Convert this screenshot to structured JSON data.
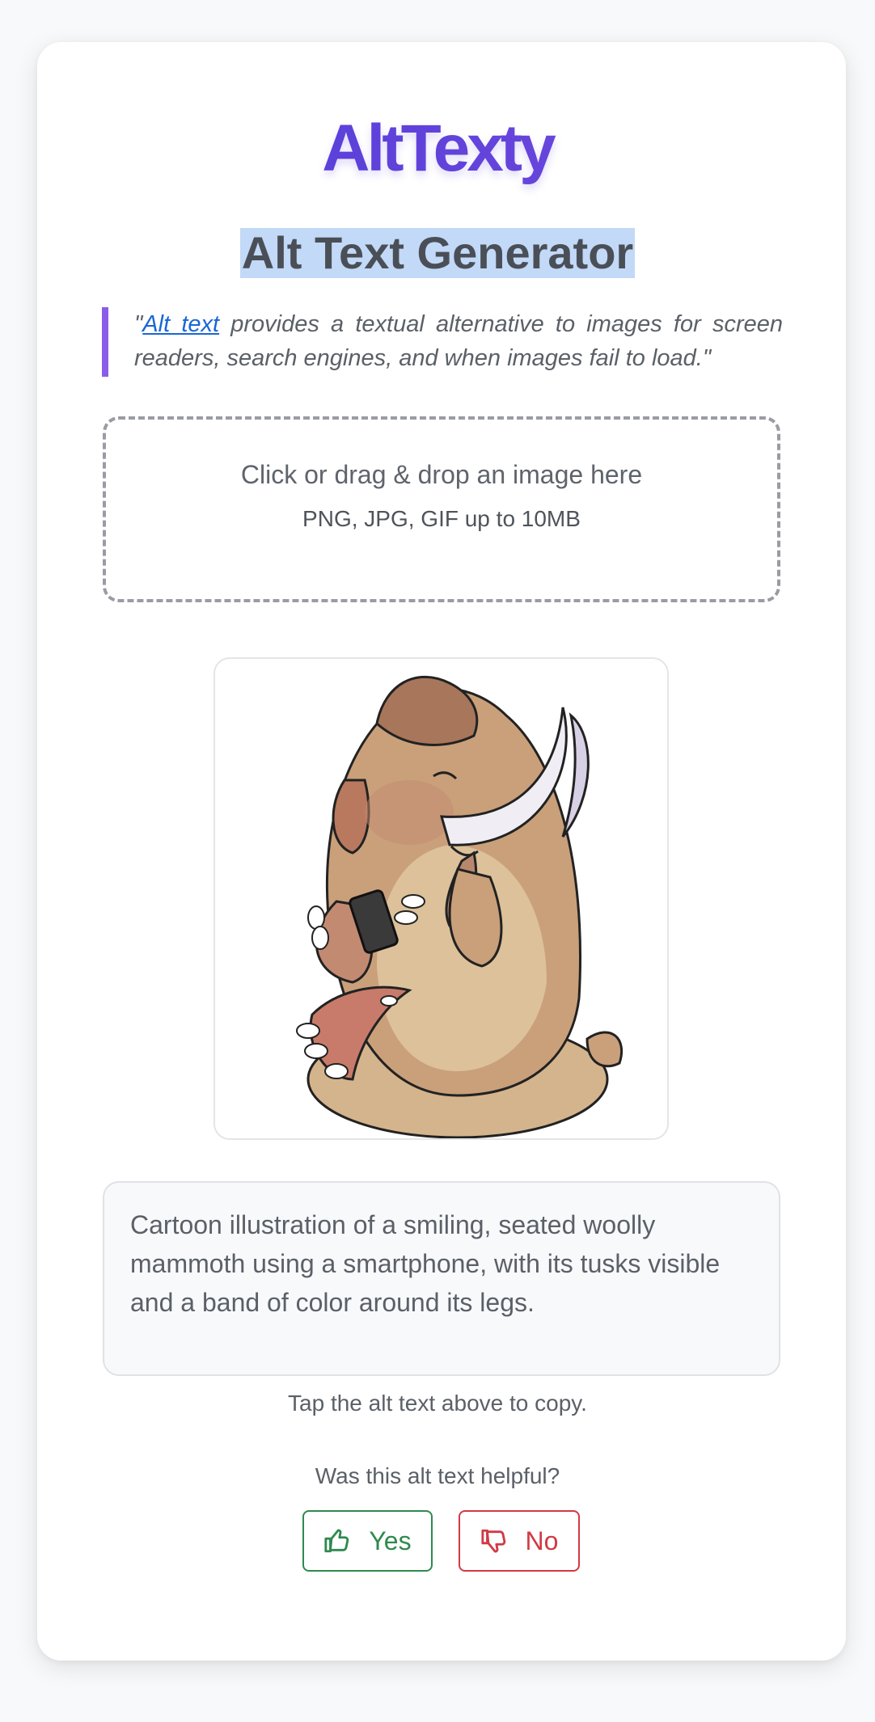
{
  "app": {
    "logo": "AltTexty",
    "title": "Alt Text Generator"
  },
  "quote": {
    "open_mark": "\"",
    "link_text": "Alt text",
    "body": " provides a textual alternative to images for screen readers, search engines, and when images fail to load.\""
  },
  "upload": {
    "main_text": "Click or drag & drop an image here",
    "sub_text": "PNG, JPG, GIF up to 10MB"
  },
  "preview": {
    "icon": "mammoth-illustration"
  },
  "result": {
    "alt_text": "Cartoon illustration of a smiling, seated woolly mammoth using a smartphone, with its tusks visible and a band of color around its legs.",
    "copy_hint": "Tap the alt text above to copy."
  },
  "feedback": {
    "question": "Was this alt text helpful?",
    "yes_label": "Yes",
    "no_label": "No",
    "yes_icon": "thumbs-up-icon",
    "no_icon": "thumbs-down-icon"
  },
  "colors": {
    "brand": "#5b3fd9",
    "accent_border": "#8b5ce8",
    "link": "#1a66d6",
    "yes": "#2e8a4e",
    "no": "#d03a44",
    "highlight": "#c2d9f7"
  }
}
